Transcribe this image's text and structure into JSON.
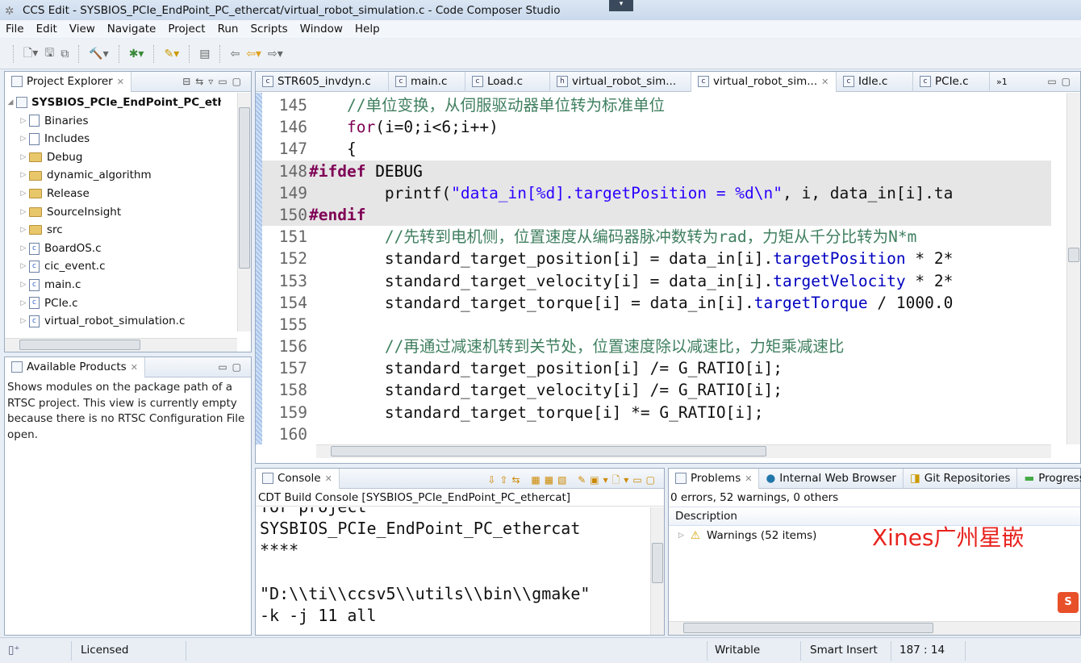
{
  "window": {
    "title": "CCS Edit - SYSBIOS_PCIe_EndPoint_PC_ethercat/virtual_robot_simulation.c - Code Composer Studio"
  },
  "menu": [
    "File",
    "Edit",
    "View",
    "Navigate",
    "Project",
    "Run",
    "Scripts",
    "Window",
    "Help"
  ],
  "project_explorer": {
    "title": "Project Explorer",
    "root": "SYSBIOS_PCIe_EndPoint_PC_ethercat",
    "items": [
      {
        "label": "Binaries",
        "icon": "binaries-icon"
      },
      {
        "label": "Includes",
        "icon": "includes-icon"
      },
      {
        "label": "Debug",
        "icon": "folder-icon"
      },
      {
        "label": "dynamic_algorithm",
        "icon": "folder-icon"
      },
      {
        "label": "Release",
        "icon": "folder-icon"
      },
      {
        "label": "SourceInsight",
        "icon": "folder-icon"
      },
      {
        "label": "src",
        "icon": "folder-icon"
      },
      {
        "label": "BoardOS.c",
        "icon": "c-file-icon"
      },
      {
        "label": "cic_event.c",
        "icon": "c-file-icon"
      },
      {
        "label": "main.c",
        "icon": "c-file-icon"
      },
      {
        "label": "PCIe.c",
        "icon": "c-file-icon"
      },
      {
        "label": "virtual_robot_simulation.c",
        "icon": "c-file-icon"
      }
    ]
  },
  "available_products": {
    "title": "Available Products",
    "text": "Shows modules on the package path of a RTSC project. This view is currently empty because there is no RTSC Configuration File open."
  },
  "editor": {
    "tabs": [
      {
        "label": "STR605_invdyn.c"
      },
      {
        "label": "main.c"
      },
      {
        "label": "Load.c"
      },
      {
        "label": "virtual_robot_sim..."
      },
      {
        "label": "virtual_robot_sim...",
        "active": true
      },
      {
        "label": "Idle.c"
      },
      {
        "label": "PCIe.c"
      }
    ],
    "overflow": "»1",
    "lines": [
      {
        "n": "145",
        "seg": [
          [
            "    ",
            ""
          ],
          [
            "//单位变换，从伺服驱动器单位转为标准单位",
            "cm"
          ]
        ]
      },
      {
        "n": "146",
        "seg": [
          [
            "    ",
            ""
          ],
          [
            "for",
            "kw"
          ],
          [
            "(i=0;i<6;i++)",
            ""
          ]
        ]
      },
      {
        "n": "147",
        "seg": [
          [
            "    {",
            ""
          ]
        ]
      },
      {
        "n": "148",
        "hl": true,
        "seg": [
          [
            "#ifdef",
            "pp"
          ],
          [
            " DEBUG",
            "ppn"
          ]
        ]
      },
      {
        "n": "149",
        "hl": true,
        "seg": [
          [
            "        printf(",
            ""
          ],
          [
            "\"data_in[%d].targetPosition = %d\\n\"",
            "str"
          ],
          [
            ", i, data_in[i].ta",
            ""
          ]
        ]
      },
      {
        "n": "150",
        "hl": true,
        "seg": [
          [
            "#endif",
            "pp"
          ]
        ]
      },
      {
        "n": "151",
        "seg": [
          [
            "        ",
            ""
          ],
          [
            "//先转到电机侧，位置速度从编码器脉冲数转为rad，力矩从千分比转为N*m",
            "cm"
          ]
        ]
      },
      {
        "n": "152",
        "seg": [
          [
            "        standard_target_position[i] = data_in[i].",
            ""
          ],
          [
            "targetPosition",
            "fld"
          ],
          [
            " * 2*",
            ""
          ]
        ]
      },
      {
        "n": "153",
        "seg": [
          [
            "        standard_target_velocity[i] = data_in[i].",
            ""
          ],
          [
            "targetVelocity",
            "fld"
          ],
          [
            " * 2*",
            ""
          ]
        ]
      },
      {
        "n": "154",
        "seg": [
          [
            "        standard_target_torque[i] = data_in[i].",
            ""
          ],
          [
            "targetTorque",
            "fld"
          ],
          [
            " / 1000.0",
            ""
          ]
        ]
      },
      {
        "n": "155",
        "seg": []
      },
      {
        "n": "156",
        "seg": [
          [
            "        ",
            ""
          ],
          [
            "//再通过减速机转到关节处，位置速度除以减速比，力矩乘减速比",
            "cm"
          ]
        ]
      },
      {
        "n": "157",
        "seg": [
          [
            "        standard_target_position[i] /= G_RATIO[i];",
            ""
          ]
        ]
      },
      {
        "n": "158",
        "seg": [
          [
            "        standard_target_velocity[i] /= G_RATIO[i];",
            ""
          ]
        ]
      },
      {
        "n": "159",
        "seg": [
          [
            "        standard_target_torque[i] *= G_RATIO[i];",
            ""
          ]
        ]
      },
      {
        "n": "160",
        "seg": []
      }
    ]
  },
  "console": {
    "title": "Console",
    "subtitle": "CDT Build Console [SYSBIOS_PCIe_EndPoint_PC_ethercat]",
    "text": "for project\nSYSBIOS_PCIe_EndPoint_PC_ethercat\n****\n\n\"D:\\\\ti\\\\ccsv5\\\\utils\\\\bin\\\\gmake\"\n-k -j 11 all"
  },
  "problems": {
    "tabs": [
      "Problems",
      "Internal Web Browser",
      "Git Repositories",
      "Progress"
    ],
    "summary": "0 errors, 52 warnings, 0 others",
    "column": "Description",
    "rows": [
      {
        "label": "Warnings (52 items)"
      }
    ],
    "watermark": "Xines广州星嵌"
  },
  "status": {
    "licensed": "Licensed",
    "mode": "Writable",
    "insert": "Smart Insert",
    "position": "187 : 14"
  },
  "colors": {
    "keyword": "#7f0055",
    "comment": "#3f7f5f",
    "string": "#2a00ff",
    "field": "#0000c0",
    "watermark": "#e8231e"
  }
}
